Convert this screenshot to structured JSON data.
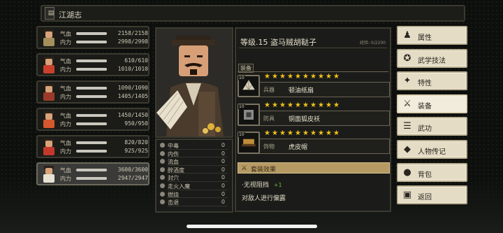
{
  "header": {
    "book_icon": "book-icon",
    "title": "江湖志"
  },
  "stat_labels": {
    "hp": "气血",
    "mp": "内力"
  },
  "party": [
    {
      "name": "member-1",
      "hp": "2158/2158",
      "mp": "2998/2998",
      "hp_ratio": 1.0,
      "mp_ratio": 1.0,
      "robe": "#a58f5c"
    },
    {
      "name": "member-2",
      "hp": "610/610",
      "mp": "1010/1010",
      "hp_ratio": 1.0,
      "mp_ratio": 1.0,
      "robe": "#c9402d"
    },
    {
      "name": "member-3",
      "hp": "1090/1090",
      "mp": "1405/1405",
      "hp_ratio": 1.0,
      "mp_ratio": 1.0,
      "robe": "#9b3a2a"
    },
    {
      "name": "member-4",
      "hp": "1450/1450",
      "mp": "950/950",
      "hp_ratio": 1.0,
      "mp_ratio": 1.0,
      "robe": "#d4572e"
    },
    {
      "name": "member-5",
      "hp": "820/820",
      "mp": "925/925",
      "hp_ratio": 1.0,
      "mp_ratio": 1.0,
      "robe": "#c2392b"
    },
    {
      "name": "member-6",
      "hp": "3600/3600",
      "mp": "2947/2947",
      "hp_ratio": 1.0,
      "mp_ratio": 1.0,
      "robe": "#e8e2d4",
      "selected": true
    }
  ],
  "statuses": [
    {
      "name": "中毒",
      "value": "0"
    },
    {
      "name": "内伤",
      "value": "0"
    },
    {
      "name": "流血",
      "value": "0"
    },
    {
      "name": "醉酒度",
      "value": "0"
    },
    {
      "name": "封穴",
      "value": "0"
    },
    {
      "name": "走火入魔",
      "value": "0"
    },
    {
      "name": "燃烧",
      "value": "0"
    },
    {
      "name": "击退",
      "value": "0"
    }
  ],
  "character": {
    "title": "等级.15 盗马贼胡鞑子",
    "exp": "经验: 0/2200"
  },
  "equipment": {
    "section_label": "装备",
    "items": [
      {
        "level": "10",
        "stars": 10,
        "type": "兵器",
        "item_name": "顿油纸扇",
        "icon": "fan-icon"
      },
      {
        "level": "10",
        "stars": 10,
        "type": "防具",
        "item_name": "铜面狐皮袄",
        "icon": "armor-icon"
      },
      {
        "level": "10",
        "stars": 10,
        "type": "饰物",
        "item_name": "虎皮帽",
        "icon": "hat-icon"
      }
    ],
    "set_label": "套装效果",
    "set_effect_1": "·无视阻挡",
    "set_effect_1_bonus": "+1",
    "set_effect_2": "对敌人进行偏露"
  },
  "menu": [
    {
      "label": "属性",
      "icon": "person-icon",
      "glyph": "♟",
      "active": false
    },
    {
      "label": "武学技法",
      "icon": "martial-arts-icon",
      "glyph": "✪",
      "active": false
    },
    {
      "label": "特性",
      "icon": "trait-icon",
      "glyph": "✦",
      "active": false
    },
    {
      "label": "装备",
      "icon": "sword-icon",
      "glyph": "⚔",
      "active": true
    },
    {
      "label": "武功",
      "icon": "scroll-icon",
      "glyph": "☰",
      "active": false
    },
    {
      "label": "人物传记",
      "icon": "book-icon",
      "glyph": "◆",
      "active": false
    },
    {
      "label": "背包",
      "icon": "bag-icon",
      "glyph": "●",
      "active": false
    },
    {
      "label": "返回",
      "icon": "back-icon",
      "glyph": "▣",
      "active": false
    }
  ]
}
